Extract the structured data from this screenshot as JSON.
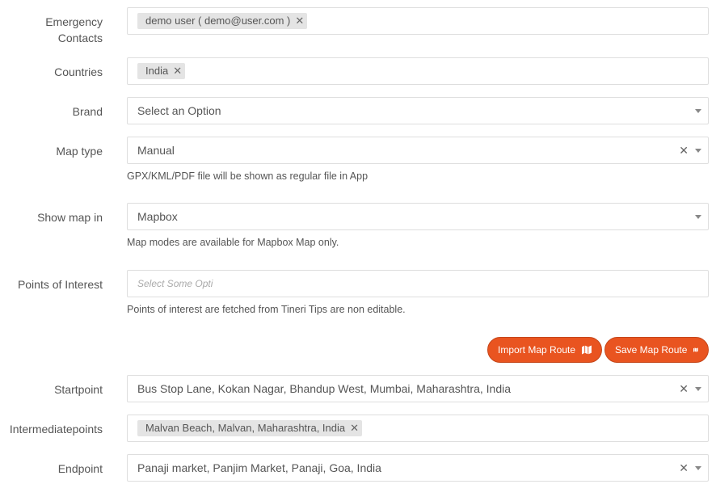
{
  "emergency_contacts": {
    "label": "Emergency Contacts",
    "label_line1": "Emergency",
    "label_line2": "Contacts",
    "tags": [
      "demo user ( demo@user.com )"
    ]
  },
  "countries": {
    "label": "Countries",
    "tags": [
      "India"
    ]
  },
  "brand": {
    "label": "Brand",
    "value": "Select an Option"
  },
  "map_type": {
    "label": "Map type",
    "value": "Manual",
    "help": "GPX/KML/PDF file will be shown as regular file in App"
  },
  "show_map_in": {
    "label": "Show map in",
    "value": "Mapbox",
    "help": "Map modes are available for Mapbox Map only."
  },
  "points_of_interest": {
    "label": "Points of Interest",
    "placeholder": "Select Some Opti",
    "help": "Points of interest are fetched from Tineri Tips are non editable."
  },
  "buttons": {
    "import_map_route": "Import Map Route",
    "save_map_route": "Save Map Route",
    "icon": "map-icon",
    "color": "#e95420"
  },
  "startpoint": {
    "label": "Startpoint",
    "value": "Bus Stop Lane, Kokan Nagar, Bhandup West, Mumbai, Maharashtra, India"
  },
  "intermediatepoints": {
    "label": "Intermediatepoints",
    "tags": [
      "Malvan Beach, Malvan, Maharashtra, India"
    ]
  },
  "endpoint": {
    "label": "Endpoint",
    "value": "Panaji market, Panjim Market, Panaji, Goa, India"
  }
}
